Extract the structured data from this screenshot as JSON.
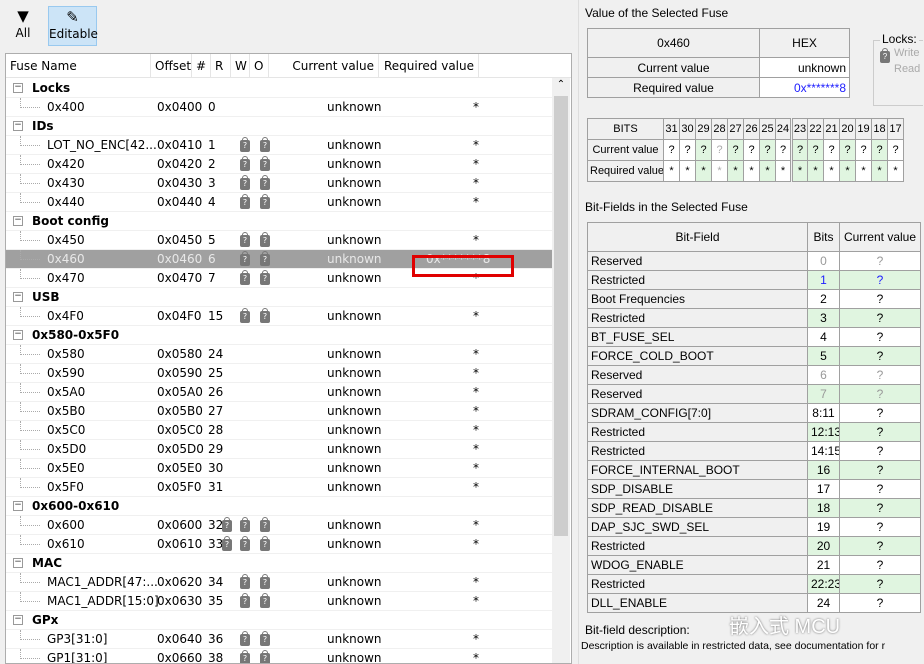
{
  "toolbar": {
    "all_label": "All",
    "editable_label": "Editable",
    "all_icon": "filter-icon",
    "editable_icon": "edit-document-icon"
  },
  "fuse_table": {
    "columns": [
      "Fuse Name",
      "Offset",
      "#",
      "R",
      "W",
      "O",
      "Current value",
      "Required value"
    ],
    "rows": [
      {
        "type": "group",
        "name": "Locks"
      },
      {
        "name": "0x400",
        "offset": "0x0400",
        "num": "0",
        "locks": "",
        "current": "unknown",
        "required": "*"
      },
      {
        "type": "group",
        "name": "IDs"
      },
      {
        "name": "LOT_NO_ENC[42...",
        "offset": "0x0410",
        "num": "1",
        "locks": "WO",
        "current": "unknown",
        "required": "*"
      },
      {
        "name": "0x420",
        "offset": "0x0420",
        "num": "2",
        "locks": "WO",
        "current": "unknown",
        "required": "*"
      },
      {
        "name": "0x430",
        "offset": "0x0430",
        "num": "3",
        "locks": "WO",
        "current": "unknown",
        "required": "*"
      },
      {
        "name": "0x440",
        "offset": "0x0440",
        "num": "4",
        "locks": "WO",
        "current": "unknown",
        "required": "*"
      },
      {
        "type": "group",
        "name": "Boot config"
      },
      {
        "name": "0x450",
        "offset": "0x0450",
        "num": "5",
        "locks": "WO",
        "current": "unknown",
        "required": "*"
      },
      {
        "name": "0x460",
        "offset": "0x0460",
        "num": "6",
        "locks": "WO",
        "current": "unknown",
        "required": "0x*******8",
        "selected": true
      },
      {
        "name": "0x470",
        "offset": "0x0470",
        "num": "7",
        "locks": "WO",
        "current": "unknown",
        "required": "*"
      },
      {
        "type": "group",
        "name": "USB"
      },
      {
        "name": "0x4F0",
        "offset": "0x04F0",
        "num": "15",
        "locks": "WO",
        "current": "unknown",
        "required": "*"
      },
      {
        "type": "group",
        "name": "0x580-0x5F0"
      },
      {
        "name": "0x580",
        "offset": "0x0580",
        "num": "24",
        "locks": "",
        "current": "unknown",
        "required": "*"
      },
      {
        "name": "0x590",
        "offset": "0x0590",
        "num": "25",
        "locks": "",
        "current": "unknown",
        "required": "*"
      },
      {
        "name": "0x5A0",
        "offset": "0x05A0",
        "num": "26",
        "locks": "",
        "current": "unknown",
        "required": "*"
      },
      {
        "name": "0x5B0",
        "offset": "0x05B0",
        "num": "27",
        "locks": "",
        "current": "unknown",
        "required": "*"
      },
      {
        "name": "0x5C0",
        "offset": "0x05C0",
        "num": "28",
        "locks": "",
        "current": "unknown",
        "required": "*"
      },
      {
        "name": "0x5D0",
        "offset": "0x05D0",
        "num": "29",
        "locks": "",
        "current": "unknown",
        "required": "*"
      },
      {
        "name": "0x5E0",
        "offset": "0x05E0",
        "num": "30",
        "locks": "",
        "current": "unknown",
        "required": "*"
      },
      {
        "name": "0x5F0",
        "offset": "0x05F0",
        "num": "31",
        "locks": "",
        "current": "unknown",
        "required": "*"
      },
      {
        "type": "group",
        "name": "0x600-0x610"
      },
      {
        "name": "0x600",
        "offset": "0x0600",
        "num": "32",
        "locks": "RWO",
        "current": "unknown",
        "required": "*"
      },
      {
        "name": "0x610",
        "offset": "0x0610",
        "num": "33",
        "locks": "RWO",
        "current": "unknown",
        "required": "*"
      },
      {
        "type": "group",
        "name": "MAC"
      },
      {
        "name": "MAC1_ADDR[47:...",
        "offset": "0x0620",
        "num": "34",
        "locks": "WO",
        "current": "unknown",
        "required": "*"
      },
      {
        "name": "MAC1_ADDR[15:0]",
        "offset": "0x0630",
        "num": "35",
        "locks": "WO",
        "current": "unknown",
        "required": "*"
      },
      {
        "type": "group",
        "name": "GPx"
      },
      {
        "name": "GP3[31:0]",
        "offset": "0x0640",
        "num": "36",
        "locks": "WO",
        "current": "unknown",
        "required": "*"
      },
      {
        "name": "GP1[31:0]",
        "offset": "0x0660",
        "num": "38",
        "locks": "WO",
        "current": "unknown",
        "required": "*"
      }
    ]
  },
  "value_panel": {
    "title": "Value of the Selected Fuse",
    "fuse": "0x460",
    "format": "HEX",
    "current_label": "Current value",
    "current_value": "unknown",
    "required_label": "Required value",
    "required_value": "0x*******8",
    "required_color": "#2020ff",
    "locks_title": "Locks:",
    "locks_write": "Write",
    "locks_read": "Read"
  },
  "bits_table": {
    "label": "BITS",
    "current_label": "Current value",
    "required_label": "Required value",
    "bits": [
      {
        "n": "31",
        "cur": "?",
        "req": "*",
        "g": false
      },
      {
        "n": "30",
        "cur": "?",
        "req": "*",
        "g": false
      },
      {
        "n": "29",
        "cur": "?",
        "req": "*",
        "g": true
      },
      {
        "n": "28",
        "cur": "?",
        "req": "*",
        "g": false,
        "dim": true
      },
      {
        "n": "27",
        "cur": "?",
        "req": "*",
        "g": true
      },
      {
        "n": "26",
        "cur": "?",
        "req": "*",
        "g": false
      },
      {
        "n": "25",
        "cur": "?",
        "req": "*",
        "g": true
      },
      {
        "n": "24",
        "cur": "?",
        "req": "*",
        "g": false
      },
      {
        "n": "23",
        "cur": "?",
        "req": "*",
        "g": true
      },
      {
        "n": "22",
        "cur": "?",
        "req": "*",
        "g": true
      },
      {
        "n": "21",
        "cur": "?",
        "req": "*",
        "g": false
      },
      {
        "n": "20",
        "cur": "?",
        "req": "*",
        "g": true
      },
      {
        "n": "19",
        "cur": "?",
        "req": "*",
        "g": false
      },
      {
        "n": "18",
        "cur": "?",
        "req": "*",
        "g": true
      },
      {
        "n": "17",
        "cur": "?",
        "req": "*",
        "g": false
      }
    ]
  },
  "bitfields": {
    "title": "Bit-Fields in the Selected Fuse",
    "columns": [
      "Bit-Field",
      "Bits",
      "Current value"
    ],
    "rows": [
      {
        "name": "Reserved",
        "bits": "0",
        "cur": "?",
        "g": false,
        "color": "#999"
      },
      {
        "name": "Restricted",
        "bits": "1",
        "cur": "?",
        "g": true,
        "color": "#2020ff"
      },
      {
        "name": "Boot Frequencies",
        "bits": "2",
        "cur": "?",
        "g": false
      },
      {
        "name": "Restricted",
        "bits": "3",
        "cur": "?",
        "g": true
      },
      {
        "name": "BT_FUSE_SEL",
        "bits": "4",
        "cur": "?",
        "g": false
      },
      {
        "name": "FORCE_COLD_BOOT",
        "bits": "5",
        "cur": "?",
        "g": true
      },
      {
        "name": "Reserved",
        "bits": "6",
        "cur": "?",
        "g": false,
        "color": "#999"
      },
      {
        "name": "Reserved",
        "bits": "7",
        "cur": "?",
        "g": true,
        "color": "#999"
      },
      {
        "name": "SDRAM_CONFIG[7:0]",
        "bits": "8:11",
        "cur": "?",
        "g": false
      },
      {
        "name": "Restricted",
        "bits": "12:13",
        "cur": "?",
        "g": true
      },
      {
        "name": "Restricted",
        "bits": "14:15",
        "cur": "?",
        "g": false
      },
      {
        "name": "FORCE_INTERNAL_BOOT",
        "bits": "16",
        "cur": "?",
        "g": true
      },
      {
        "name": "SDP_DISABLE",
        "bits": "17",
        "cur": "?",
        "g": false
      },
      {
        "name": "SDP_READ_DISABLE",
        "bits": "18",
        "cur": "?",
        "g": true
      },
      {
        "name": "DAP_SJC_SWD_SEL",
        "bits": "19",
        "cur": "?",
        "g": false
      },
      {
        "name": "Restricted",
        "bits": "20",
        "cur": "?",
        "g": true
      },
      {
        "name": "WDOG_ENABLE",
        "bits": "21",
        "cur": "?",
        "g": false
      },
      {
        "name": "Restricted",
        "bits": "22:23",
        "cur": "?",
        "g": true
      },
      {
        "name": "DLL_ENABLE",
        "bits": "24",
        "cur": "?",
        "g": false
      }
    ],
    "desc_label": "Bit-field description:",
    "desc_text": "Description is available in restricted data, see documentation for r"
  },
  "watermark": "嵌入式 MCU",
  "highlight_color": "#e00000"
}
